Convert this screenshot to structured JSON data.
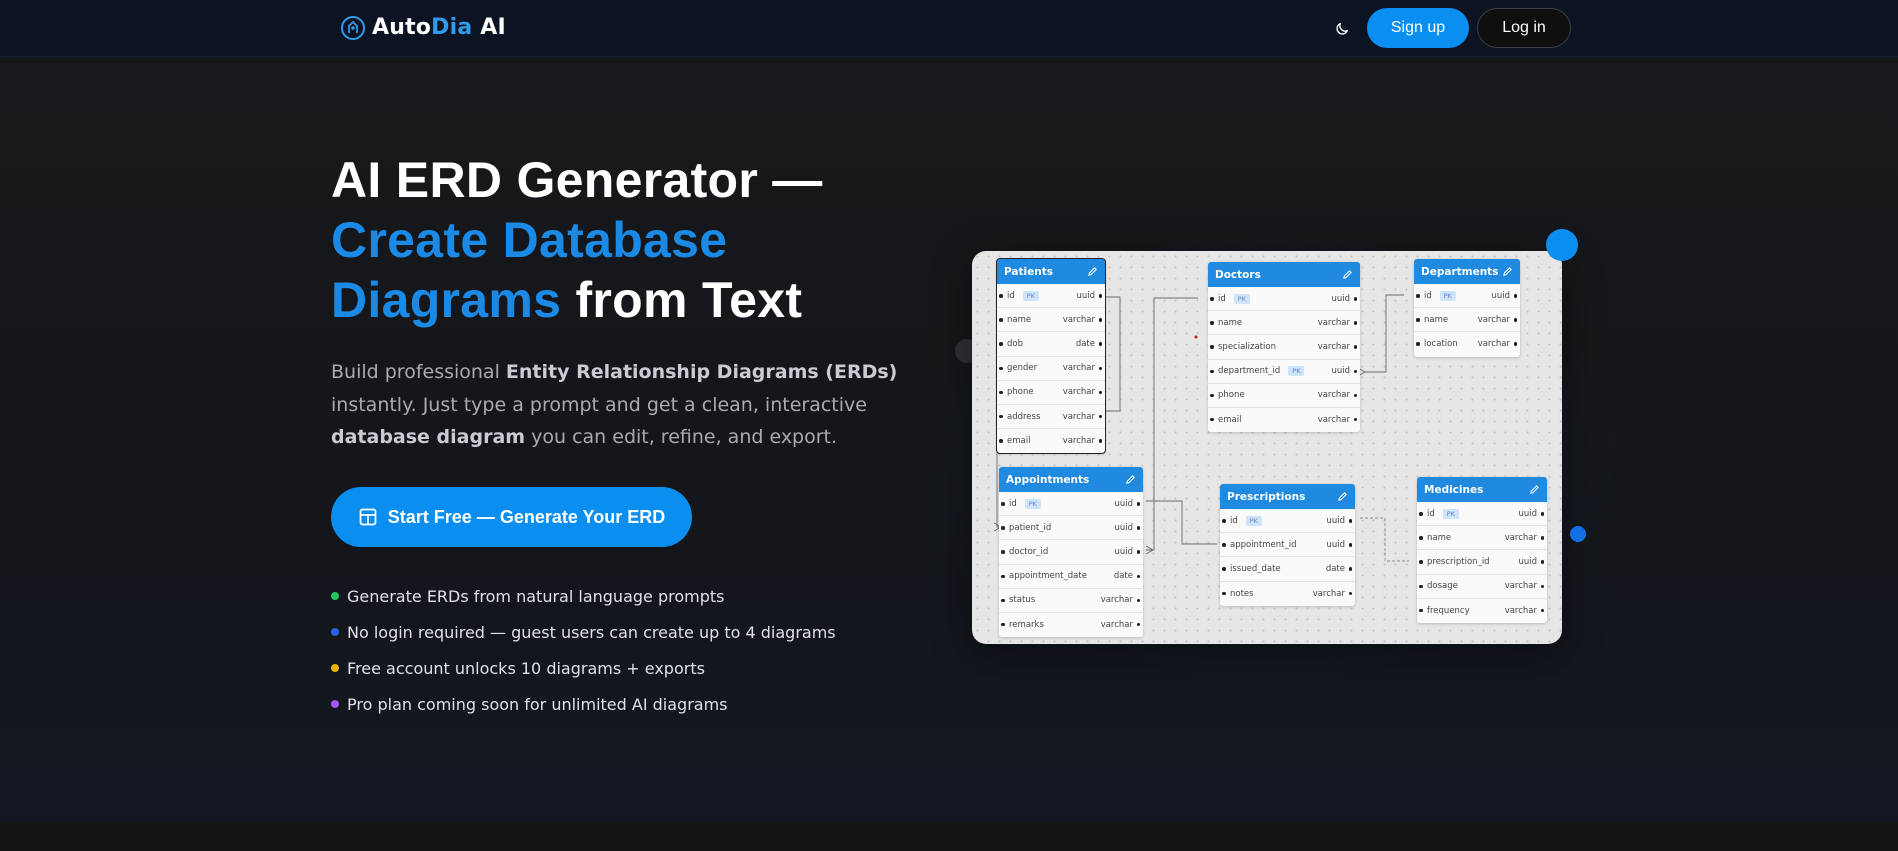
{
  "nav": {
    "brand_auto": "Auto",
    "brand_dia": "Dia",
    "brand_ai": " AI",
    "theme_icon": "moon-icon",
    "signup_label": "Sign up",
    "login_label": "Log in"
  },
  "hero": {
    "title_line1": "AI ERD Generator —",
    "title_blue": "Create Database Diagrams",
    "title_end": " from Text",
    "lead_1": "Build professional ",
    "lead_b1": "Entity Relationship Diagrams (ERDs)",
    "lead_2": " instantly. Just type a prompt and get a clean, interactive ",
    "lead_b2": "database diagram",
    "lead_3": " you can edit, refine, and export.",
    "cta_label": "Start Free — Generate Your ERD",
    "bullets": [
      {
        "text": "Generate ERDs from natural language prompts",
        "color": "#22c55e"
      },
      {
        "text": "No login required — guest users can create up to 4 diagrams",
        "color": "#2563eb"
      },
      {
        "text": "Free account unlocks 10 diagrams + exports",
        "color": "#eab308"
      },
      {
        "text": "Pro plan coming soon for unlimited AI diagrams",
        "color": "#a855f7"
      }
    ]
  },
  "diagram": {
    "pk_label": "PK",
    "tables": [
      {
        "name": "Patients",
        "fields": [
          {
            "name": "id",
            "type": "uuid",
            "pk": true
          },
          {
            "name": "name",
            "type": "varchar"
          },
          {
            "name": "dob",
            "type": "date"
          },
          {
            "name": "gender",
            "type": "varchar"
          },
          {
            "name": "phone",
            "type": "varchar"
          },
          {
            "name": "address",
            "type": "varchar"
          },
          {
            "name": "email",
            "type": "varchar"
          }
        ]
      },
      {
        "name": "Doctors",
        "fields": [
          {
            "name": "id",
            "type": "uuid",
            "pk": true
          },
          {
            "name": "name",
            "type": "varchar"
          },
          {
            "name": "specialization",
            "type": "varchar"
          },
          {
            "name": "department_id",
            "type": "uuid",
            "fk": true
          },
          {
            "name": "phone",
            "type": "varchar"
          },
          {
            "name": "email",
            "type": "varchar"
          }
        ]
      },
      {
        "name": "Departments",
        "fields": [
          {
            "name": "id",
            "type": "uuid",
            "pk": true
          },
          {
            "name": "name",
            "type": "varchar"
          },
          {
            "name": "location",
            "type": "varchar"
          }
        ]
      },
      {
        "name": "Appointments",
        "fields": [
          {
            "name": "id",
            "type": "uuid",
            "pk": true
          },
          {
            "name": "patient_id",
            "type": "uuid"
          },
          {
            "name": "doctor_id",
            "type": "uuid"
          },
          {
            "name": "appointment_date",
            "type": "date"
          },
          {
            "name": "status",
            "type": "varchar"
          },
          {
            "name": "remarks",
            "type": "varchar"
          }
        ]
      },
      {
        "name": "Prescriptions",
        "fields": [
          {
            "name": "id",
            "type": "uuid",
            "pk": true
          },
          {
            "name": "appointment_id",
            "type": "uuid"
          },
          {
            "name": "issued_date",
            "type": "date"
          },
          {
            "name": "notes",
            "type": "varchar"
          }
        ]
      },
      {
        "name": "Medicines",
        "fields": [
          {
            "name": "id",
            "type": "uuid",
            "pk": true
          },
          {
            "name": "name",
            "type": "varchar"
          },
          {
            "name": "prescription_id",
            "type": "uuid"
          },
          {
            "name": "dosage",
            "type": "varchar"
          },
          {
            "name": "frequency",
            "type": "varchar"
          }
        ]
      }
    ]
  }
}
